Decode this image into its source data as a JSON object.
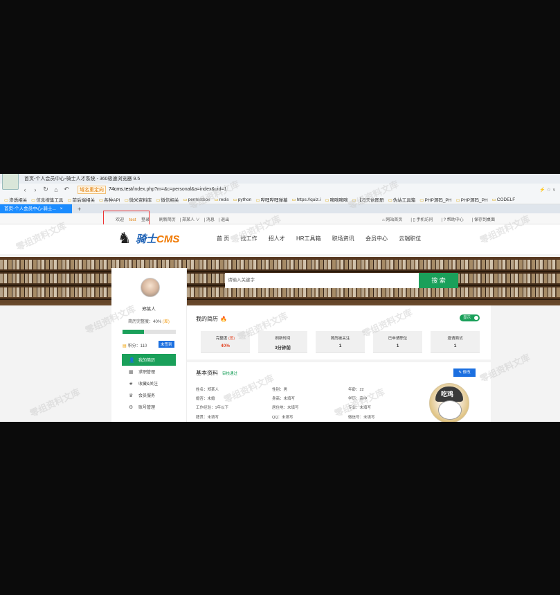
{
  "browser": {
    "title": "首页-个人会员中心-骑士人才系统 - 360极速浏览器 9.5",
    "redirect_label": "域名重定向",
    "url_host": "74cms.test",
    "url_path": "/index.php?m=&c=personal&a=index&uid=1",
    "bookmarks": [
      "渗透相关",
      "信息搜集工具",
      "前后端相关",
      "各种API",
      "微米资料库",
      "微信相关",
      "pentestbox",
      "redis",
      "python",
      "哔哩哔哩弹幕",
      "https://quiz.i",
      "嘀嘀嘀嘀",
      "【冯天依图册",
      "伪站工具箱",
      "PHP源码_PH",
      "PHP源码_PH",
      "CODELF"
    ],
    "tab_label": "首页-个人会员中心-骑士..."
  },
  "topbar": {
    "welcome": "欢迎",
    "username": "test",
    "welcome_suffix": "登录",
    "links_left": [
      "刷新简历",
      "郑某人 ∨",
      "消息",
      "退出"
    ],
    "links_right": [
      "网站首页",
      "手机访问",
      "帮助中心",
      "保存到桌面"
    ]
  },
  "header": {
    "logo_text_a": "骑士",
    "logo_text_b": "CMS",
    "nav": [
      "首 页",
      "找工作",
      "招人才",
      "HR工具箱",
      "职场资讯",
      "会员中心",
      "云端职位"
    ]
  },
  "search": {
    "placeholder": "请输入关键字",
    "button": "搜 索"
  },
  "sidebar": {
    "name": "郑某人",
    "completion_label": "简历完整度：40%",
    "completion_tag": "(差)",
    "completion_percent": 40,
    "points_label": "积分：110",
    "signin_label": "未签到",
    "menu": [
      {
        "label": "我的简历",
        "icon": "user-icon",
        "active": true
      },
      {
        "label": "求职管理",
        "icon": "briefcase-icon",
        "active": false
      },
      {
        "label": "收藏&关注",
        "icon": "star-icon",
        "active": false
      },
      {
        "label": "会员服务",
        "icon": "crown-icon",
        "active": false
      },
      {
        "label": "账号管理",
        "icon": "gear-icon",
        "active": false
      }
    ]
  },
  "resume": {
    "title": "我的简历",
    "toggle": "显示",
    "stats": [
      {
        "label": "完整度",
        "tag": "(差)",
        "value": "40%"
      },
      {
        "label": "刷新时间",
        "tag": "",
        "value": "3分钟前"
      },
      {
        "label": "简历被关注",
        "tag": "",
        "value": "1"
      },
      {
        "label": "已申请职位",
        "tag": "",
        "value": "1"
      },
      {
        "label": "邀请面试",
        "tag": "",
        "value": "1"
      }
    ]
  },
  "basic": {
    "title": "基本资料",
    "status": "审核通过",
    "edit": "修改",
    "col1": [
      "姓名：郑某人",
      "婚否：未婚",
      "工作经验：1年以下",
      "籍贯：未填写"
    ],
    "col2": [
      "性别：男",
      "身高：未填写",
      "居住地：未填写",
      "QQ：未填写"
    ],
    "col3": [
      "年龄：22",
      "学历：高中",
      "专业：未填写",
      "微信号：未填写"
    ],
    "photo_text": "吃鸡"
  },
  "watermark": "零组资料文库"
}
